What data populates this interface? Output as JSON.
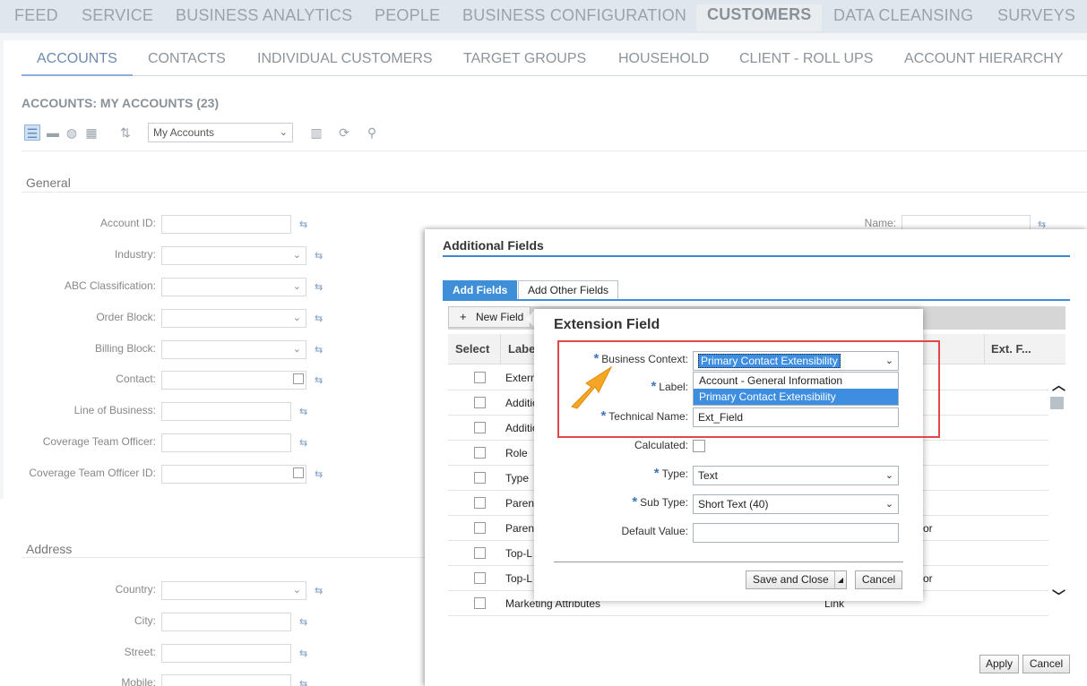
{
  "topnav": {
    "items": [
      "FEED",
      "SERVICE",
      "BUSINESS ANALYTICS",
      "PEOPLE",
      "BUSINESS CONFIGURATION",
      "CUSTOMERS",
      "DATA CLEANSING",
      "SURVEYS"
    ],
    "active": "CUSTOMERS"
  },
  "subnav": {
    "items": [
      "ACCOUNTS",
      "CONTACTS",
      "INDIVIDUAL CUSTOMERS",
      "TARGET GROUPS",
      "HOUSEHOLD",
      "CLIENT - ROLL UPS",
      "ACCOUNT HIERARCHY"
    ],
    "active": "ACCOUNTS"
  },
  "page": {
    "title": "ACCOUNTS: MY ACCOUNTS (23)"
  },
  "toolbar": {
    "view_select": "My Accounts"
  },
  "sections": {
    "general": "General",
    "address": "Address"
  },
  "general_fields": [
    {
      "label": "Account ID:"
    },
    {
      "label": "Industry:"
    },
    {
      "label": "ABC Classification:"
    },
    {
      "label": "Order Block:"
    },
    {
      "label": "Billing Block:"
    },
    {
      "label": "Contact:"
    },
    {
      "label": "Line of Business:"
    },
    {
      "label": "Coverage Team Officer:"
    },
    {
      "label": "Coverage Team Officer ID:"
    }
  ],
  "name_field": {
    "label": "Name:"
  },
  "address_fields": [
    {
      "label": "Country:"
    },
    {
      "label": "City:"
    },
    {
      "label": "Street:"
    },
    {
      "label": "Mobile:"
    }
  ],
  "additional_fields_dialog": {
    "title": "Additional Fields",
    "tabs": [
      "Add Fields",
      "Add Other Fields"
    ],
    "new_field_button": "New Field",
    "columns": [
      "Select",
      "Label",
      "Ext. F..."
    ],
    "rows": [
      {
        "label": "Extern",
        "type": ""
      },
      {
        "label": "Additio",
        "type": ""
      },
      {
        "label": "Additio",
        "type": ""
      },
      {
        "label": "Role",
        "type": ""
      },
      {
        "label": "Type",
        "type": ""
      },
      {
        "label": "Paren",
        "type": ""
      },
      {
        "label": "Paren",
        "type": "or"
      },
      {
        "label": "Top-L",
        "type": ""
      },
      {
        "label": "Top-L",
        "type": "or"
      },
      {
        "label": "Marketing Attributes",
        "type": "Link"
      }
    ],
    "apply_button": "Apply",
    "cancel_button": "Cancel"
  },
  "extension_field": {
    "title": "Extension Field",
    "business_context_label": "Business Context:",
    "business_context_value": "Primary Contact Extensibility",
    "business_context_options": [
      "Account - General Information",
      "Primary Contact Extensibility"
    ],
    "label_label": "Label:",
    "technical_name_label": "Technical Name:",
    "technical_name_value": "Ext_Field",
    "calculated_label": "Calculated:",
    "type_label": "Type:",
    "type_value": "Text",
    "subtype_label": "Sub Type:",
    "subtype_value": "Short Text (40)",
    "default_value_label": "Default Value:",
    "save_close_button": "Save and Close",
    "cancel_button": "Cancel"
  },
  "colors": {
    "accent": "#3f8fd8",
    "highlight": "#e04747",
    "arrow": "#f5a623"
  }
}
